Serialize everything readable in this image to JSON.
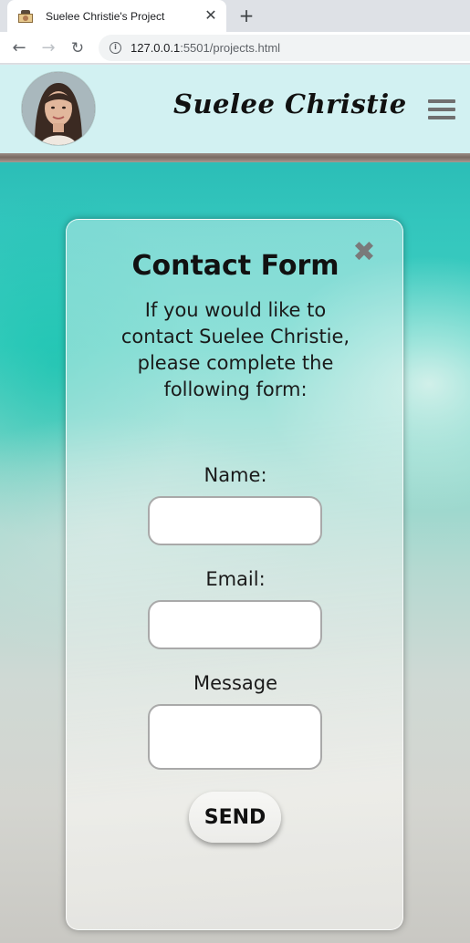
{
  "browser": {
    "tab_title": "Suelee Christie's Project",
    "tab_close_glyph": "✕",
    "new_tab_glyph": "+",
    "back_glyph": "←",
    "forward_glyph": "→",
    "reload_glyph": "↻",
    "info_glyph": "i",
    "url_host": "127.0.0.1",
    "url_rest": ":5501/projects.html"
  },
  "header": {
    "site_title": "Suelee Christie",
    "menu_icon": "hamburger-menu-icon",
    "header_bg": "#d2f1f2"
  },
  "modal": {
    "close_glyph": "✖",
    "title": "Contact Form",
    "intro": "If you would like to contact Suelee Christie, please complete the following form:",
    "fields": {
      "name_label": "Name:",
      "email_label": "Email:",
      "message_label": "Message"
    },
    "send_label": "SEND"
  }
}
